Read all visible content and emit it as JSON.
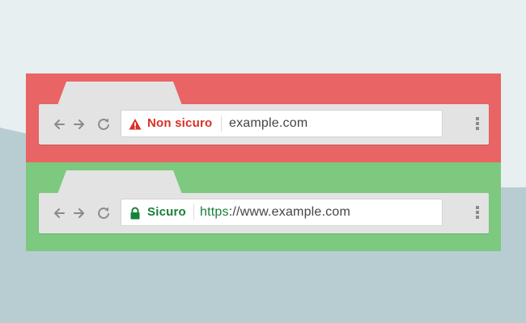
{
  "colors": {
    "page_bg": "#e7eff0",
    "hill": "#b8cdd2",
    "insecure_panel": "#e96465",
    "secure_panel": "#7dc97f",
    "insecure_text": "#d93025",
    "secure_text": "#188038",
    "url_text": "#444444"
  },
  "insecure": {
    "badge_icon": "warning-triangle-icon",
    "badge_label": "Non sicuro",
    "url": "example.com"
  },
  "secure": {
    "badge_icon": "padlock-icon",
    "badge_label": "Sicuro",
    "url_scheme": "https",
    "url_rest": "://www.example.com"
  },
  "toolbar": {
    "back_icon": "arrow-left-icon",
    "forward_icon": "arrow-right-icon",
    "reload_icon": "reload-icon",
    "menu_icon": "kebab-menu-icon"
  }
}
